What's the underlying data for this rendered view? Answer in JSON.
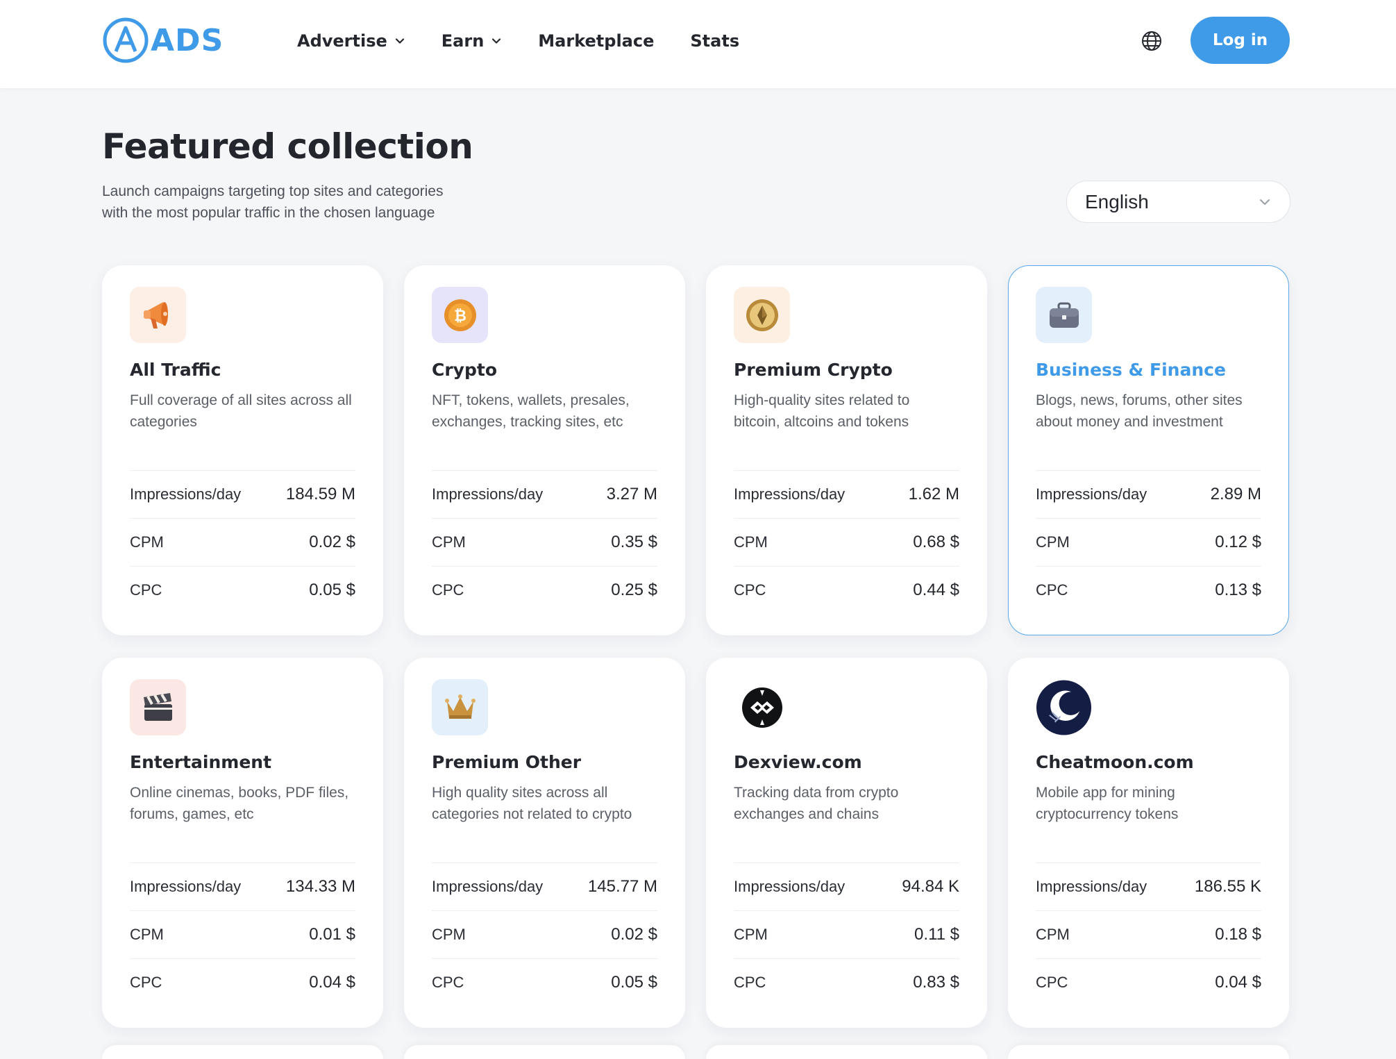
{
  "header": {
    "logo_text": "ADS",
    "nav": [
      {
        "label": "Advertise",
        "has_dropdown": true
      },
      {
        "label": "Earn",
        "has_dropdown": true
      },
      {
        "label": "Marketplace",
        "has_dropdown": false
      },
      {
        "label": "Stats",
        "has_dropdown": false
      }
    ],
    "login_label": "Log in"
  },
  "section": {
    "title": "Featured collection",
    "subtitle_line1": "Launch campaigns targeting top sites and categories",
    "subtitle_line2": "with the most popular traffic in the chosen language",
    "language_selected": "English"
  },
  "stat_labels": {
    "impressions": "Impressions/day",
    "cpm": "CPM",
    "cpc": "CPC"
  },
  "cards": [
    {
      "icon": "megaphone-icon",
      "title": "All Traffic",
      "desc": "Full coverage of all sites across all categories",
      "impressions": "184.59 M",
      "cpm": "0.02 $",
      "cpc": "0.05 $"
    },
    {
      "icon": "bitcoin-coin-icon",
      "title": "Crypto",
      "desc": "NFT, tokens, wallets, presales, exchanges, tracking sites, etc",
      "impressions": "3.27 M",
      "cpm": "0.35 $",
      "cpc": "0.25 $"
    },
    {
      "icon": "gold-coin-icon",
      "title": "Premium Crypto",
      "desc": "High-quality sites related to bitcoin, altcoins and tokens",
      "impressions": "1.62 M",
      "cpm": "0.68 $",
      "cpc": "0.44 $"
    },
    {
      "icon": "briefcase-icon",
      "title": "Business & Finance",
      "desc": "Blogs, news, forums, other sites about money and investment",
      "impressions": "2.89 M",
      "cpm": "0.12 $",
      "cpc": "0.13 $"
    },
    {
      "icon": "clapperboard-icon",
      "title": "Entertainment",
      "desc": "Online cinemas, books, PDF files, forums, games, etc",
      "impressions": "134.33 M",
      "cpm": "0.01 $",
      "cpc": "0.04 $"
    },
    {
      "icon": "crown-icon",
      "title": "Premium Other",
      "desc": "High quality sites across all categories not related to crypto",
      "impressions": "145.77 M",
      "cpm": "0.02 $",
      "cpc": "0.05 $"
    },
    {
      "icon": "dexview-logo-icon",
      "title": "Dexview.com",
      "desc": "Tracking data from crypto exchanges and chains",
      "impressions": "94.84 K",
      "cpm": "0.11 $",
      "cpc": "0.83 $"
    },
    {
      "icon": "moon-logo-icon",
      "title": "Cheatmoon.com",
      "desc": "Mobile app for mining cryptocurrency tokens",
      "impressions": "186.55 K",
      "cpm": "0.18 $",
      "cpc": "0.04 $"
    }
  ],
  "colors": {
    "accent": "#3f9be8",
    "text": "#23262c",
    "muted": "#5b5f67",
    "page_bg": "#f5f6f8"
  }
}
